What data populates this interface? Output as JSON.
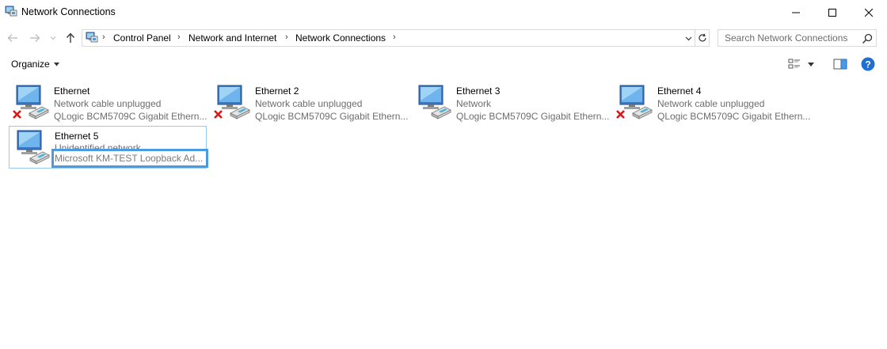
{
  "window": {
    "title": "Network Connections",
    "icon": "network-connections-icon"
  },
  "titlebar_buttons": {
    "minimize": "minimize-icon",
    "maximize": "maximize-icon",
    "close": "close-icon"
  },
  "navigation": {
    "breadcrumbs": [
      "Control Panel",
      "Network and Internet",
      "Network Connections"
    ]
  },
  "search": {
    "placeholder": "Search Network Connections"
  },
  "toolbar": {
    "organize_label": "Organize"
  },
  "connections": [
    {
      "name": "Ethernet",
      "status": "Network cable unplugged",
      "device": "QLogic BCM5709C Gigabit Ethern...",
      "disconnected": true
    },
    {
      "name": "Ethernet 2",
      "status": "Network cable unplugged",
      "device": "QLogic BCM5709C Gigabit Ethern...",
      "disconnected": true
    },
    {
      "name": "Ethernet 3",
      "status": "Network",
      "device": "QLogic BCM5709C Gigabit Ethern...",
      "disconnected": false
    },
    {
      "name": "Ethernet 4",
      "status": "Network cable unplugged",
      "device": "QLogic BCM5709C Gigabit Ethern...",
      "disconnected": true
    },
    {
      "name": "Ethernet 5",
      "status": "Unidentified network",
      "device": "Microsoft KM-TEST Loopback Ad...",
      "disconnected": false,
      "selected": true
    }
  ],
  "colors": {
    "selection_border": "#99c9ef",
    "rename_border": "#4a9be2",
    "help_blue": "#1e6fd0",
    "error_red": "#d11a1a"
  }
}
